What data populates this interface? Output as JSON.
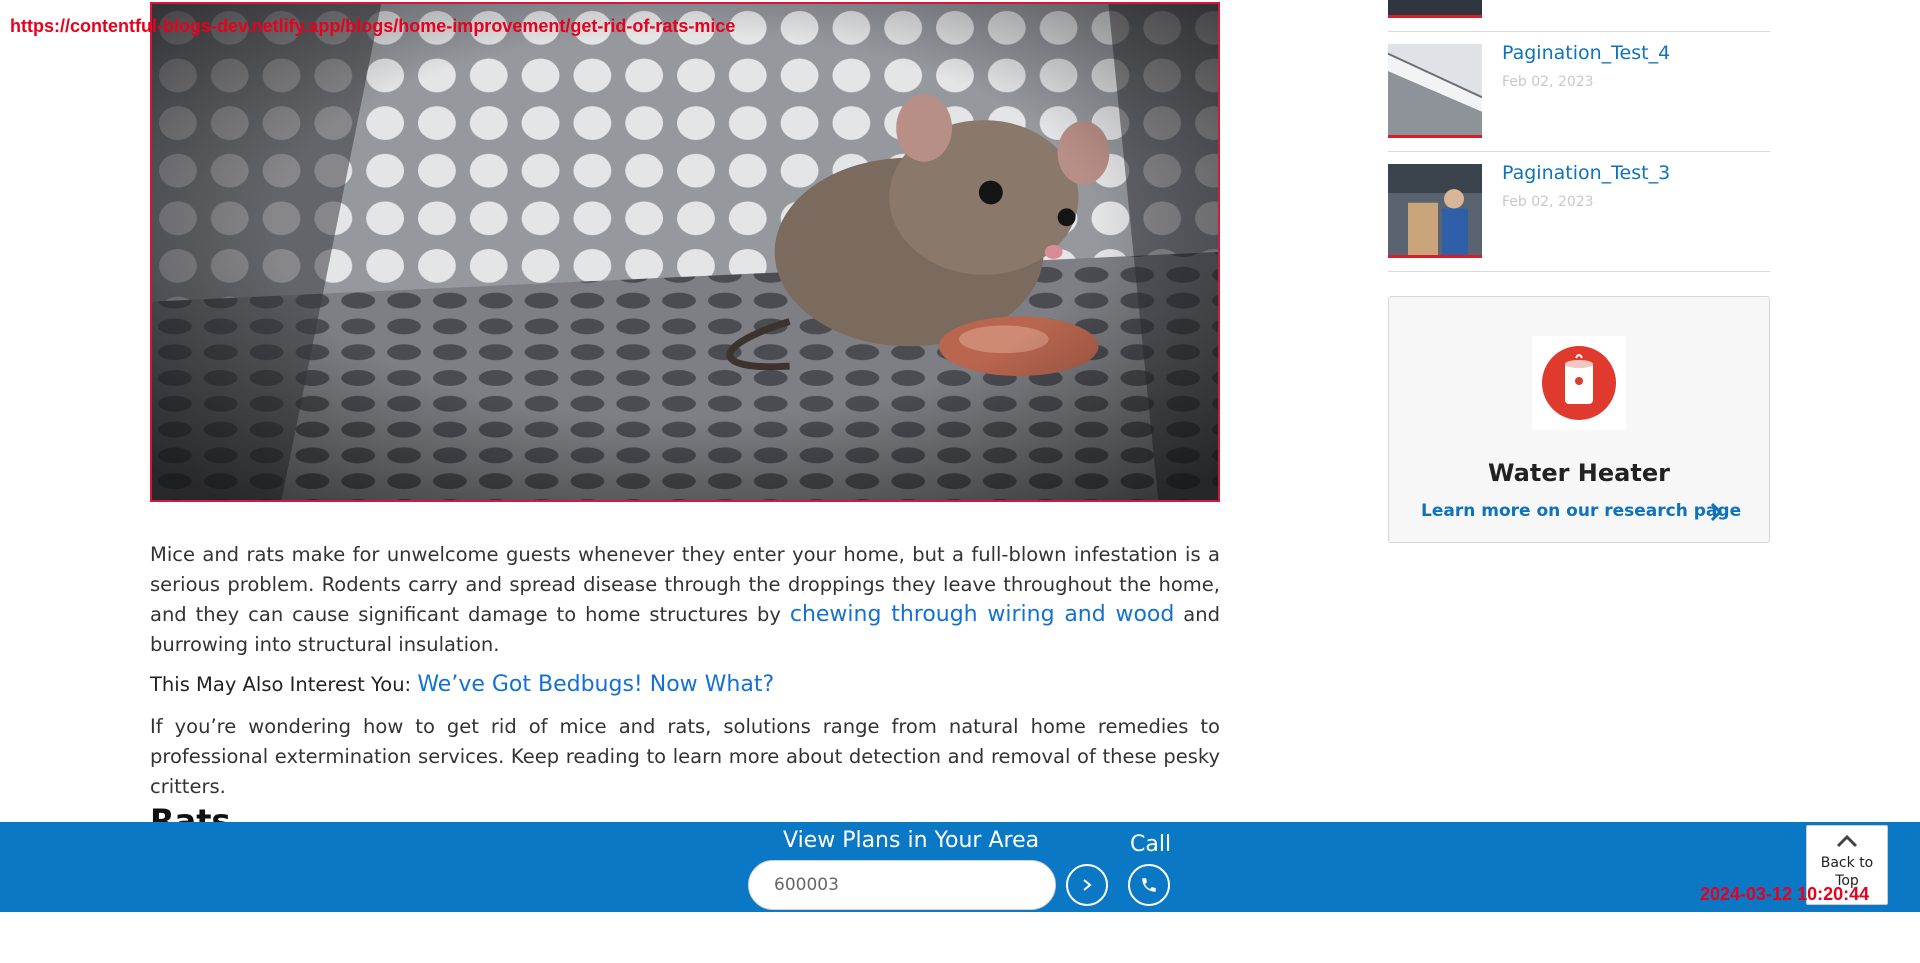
{
  "overlay": {
    "url": "https://contentful-blogs-dev.netlify.app/blogs/home-improvement/get-rid-of-rats-mice",
    "timestamp": "2024-03-12 10:20:44"
  },
  "article": {
    "para1_a": "Mice and rats make for unwelcome guests whenever they enter your home, but a full-blown infestation is a serious problem. Rodents carry and spread disease through the droppings they leave throughout the home, and they can cause significant damage to home structures by ",
    "para1_link": "chewing through wiring and wood",
    "para1_b": " and burrowing into structural insulation.",
    "interest_label": "This May Also Interest You: ",
    "interest_link": "We’ve Got Bedbugs! Now What?",
    "para2": "If you’re wondering how to get rid of mice and rats, solutions range from natural home remedies to professional extermination services. Keep reading to learn more about detection and removal of these pesky critters.",
    "next_heading": "Rats"
  },
  "sidebar": {
    "posts": [
      {
        "title": "Pagination_Test_4",
        "date": "Feb 02, 2023"
      },
      {
        "title": "Pagination_Test_3",
        "date": "Feb 02, 2023"
      }
    ],
    "card": {
      "title": "Water Heater",
      "link": "Learn more on our research page",
      "icon": "water-heater-icon",
      "icon_color": "#e03a2e"
    }
  },
  "footer": {
    "plans_label": "View Plans in Your Area",
    "zip_value": "600003",
    "call_label": "Call",
    "back_to_top": "Back to Top",
    "bar_color": "#0b78c6"
  }
}
